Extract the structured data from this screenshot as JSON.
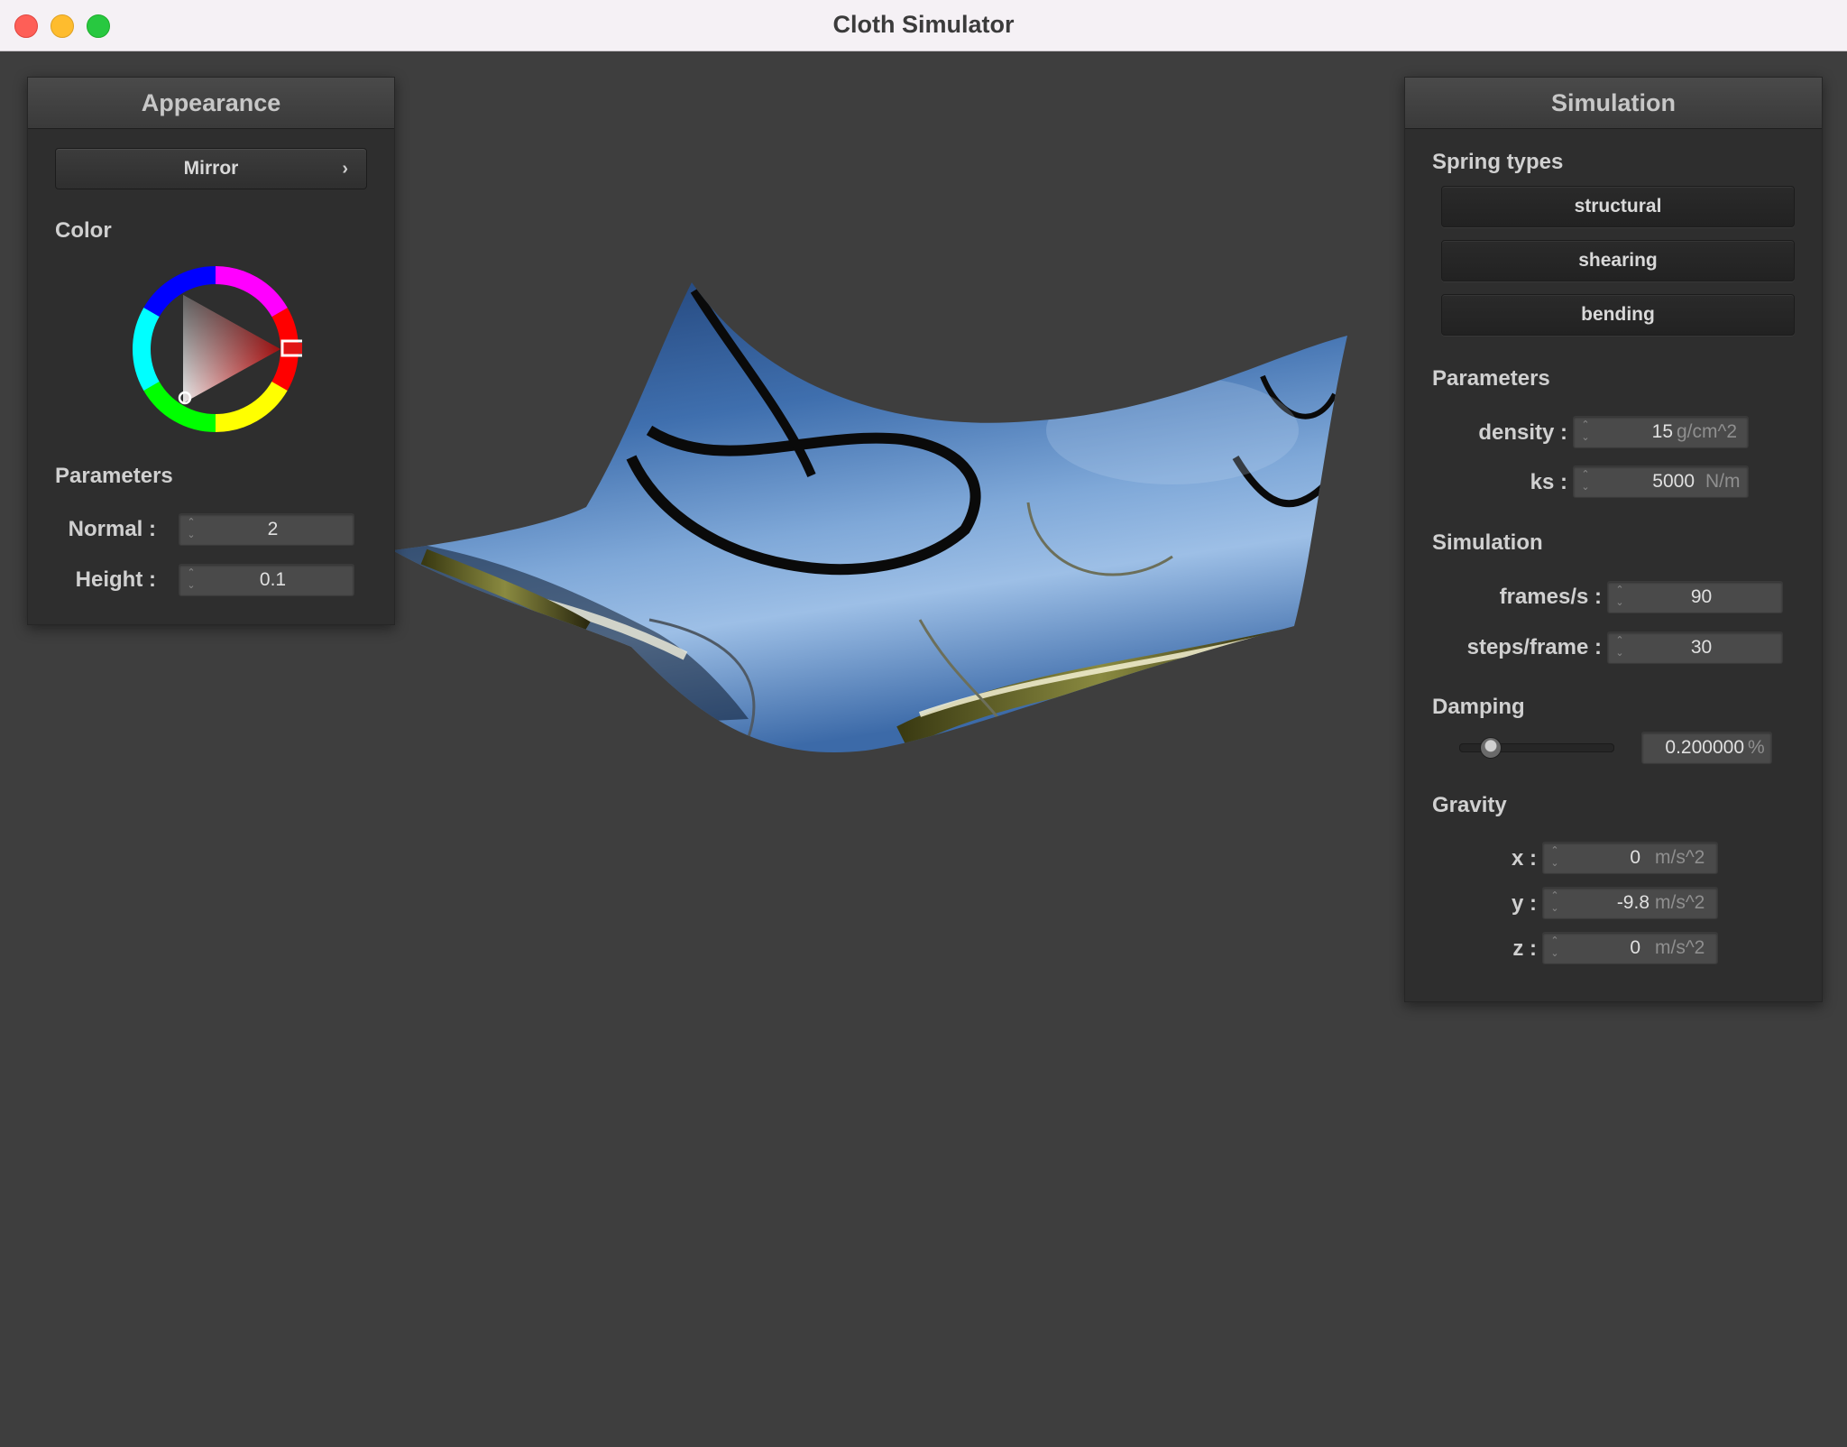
{
  "window": {
    "title": "Cloth Simulator"
  },
  "appearance": {
    "title": "Appearance",
    "shader_dropdown": "Mirror",
    "color_label": "Color",
    "parameters_label": "Parameters",
    "normal_label": "Normal :",
    "normal_value": "2",
    "height_label": "Height :",
    "height_value": "0.1",
    "picked_color": "#e01515"
  },
  "simulation": {
    "title": "Simulation",
    "spring_types_label": "Spring types",
    "spring_buttons": [
      "structural",
      "shearing",
      "bending"
    ],
    "parameters_label": "Parameters",
    "density_label": "density :",
    "density_value": "15",
    "density_unit": "g/cm^2",
    "ks_label": "ks :",
    "ks_value": "5000",
    "ks_unit": "N/m",
    "simulation_label": "Simulation",
    "fps_label": "frames/s :",
    "fps_value": "90",
    "steps_label": "steps/frame :",
    "steps_value": "30",
    "damping_label": "Damping",
    "damping_value": "0.200000",
    "damping_unit": "%",
    "damping_slider_fraction": 0.2,
    "gravity_label": "Gravity",
    "gx_label": "x :",
    "gx_value": "0",
    "gy_label": "y :",
    "gy_value": "-9.8",
    "gz_label": "z :",
    "gz_value": "0",
    "gravity_unit": "m/s^2"
  }
}
